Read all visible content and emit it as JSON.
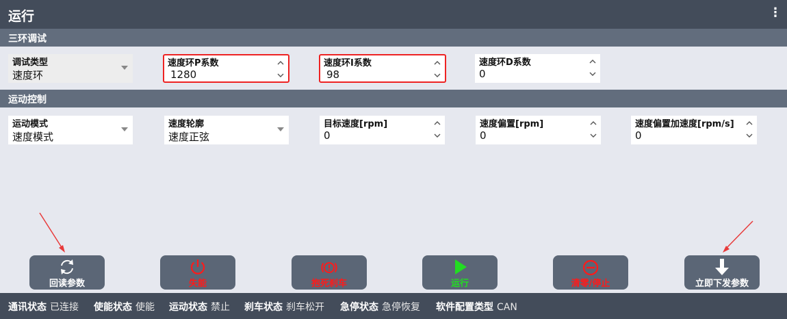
{
  "window": {
    "title": "运行"
  },
  "sections": {
    "three_loop": "三环调试",
    "motion": "运动控制"
  },
  "fields": {
    "debug_type": {
      "label": "调试类型",
      "value": "速度环"
    },
    "speed_p": {
      "label": "速度环P系数",
      "value": "1280"
    },
    "speed_i": {
      "label": "速度环I系数",
      "value": "98"
    },
    "speed_d": {
      "label": "速度环D系数",
      "value": "0"
    },
    "motion_mode": {
      "label": "运动模式",
      "value": "速度模式"
    },
    "speed_profile": {
      "label": "速度轮廓",
      "value": "速度正弦"
    },
    "target_speed": {
      "label": "目标速度[rpm]",
      "value": "0"
    },
    "speed_offset": {
      "label": "速度偏置[rpm]",
      "value": "0"
    },
    "offset_accel": {
      "label": "速度偏置加速度[rpm/s]",
      "value": "0"
    }
  },
  "buttons": {
    "read_back": {
      "label": "回读参数",
      "color": "#ffffff",
      "icon": "refresh-icon"
    },
    "disable": {
      "label": "失能",
      "color": "#ff1a1a",
      "icon": "power-icon"
    },
    "brake": {
      "label": "抱死刹车",
      "color": "#ff1a1a",
      "icon": "brake-icon"
    },
    "run": {
      "label": "运行",
      "color": "#22dd22",
      "icon": "play-icon"
    },
    "clear_stop": {
      "label": "清零/停止",
      "color": "#ff1a1a",
      "icon": "stop-icon"
    },
    "download": {
      "label": "立即下发参数",
      "color": "#ffffff",
      "icon": "arrow-down-icon"
    }
  },
  "status": [
    {
      "key": "通讯状态",
      "value": "已连接"
    },
    {
      "key": "使能状态",
      "value": "使能"
    },
    {
      "key": "运动状态",
      "value": "禁止"
    },
    {
      "key": "刹车状态",
      "value": "刹车松开"
    },
    {
      "key": "急停状态",
      "value": "急停恢复"
    },
    {
      "key": "软件配置类型",
      "value": "CAN"
    }
  ]
}
